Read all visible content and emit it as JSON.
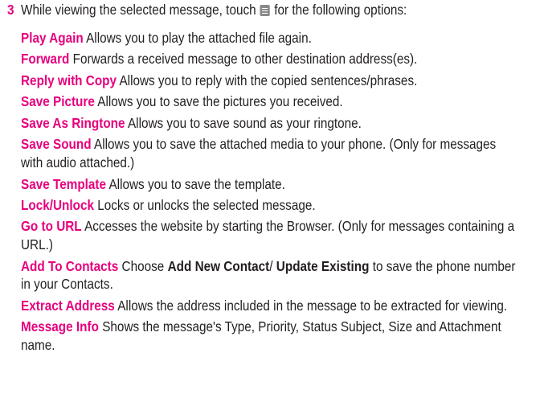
{
  "step": {
    "number": "3",
    "intro_before": "While viewing the selected message, touch",
    "intro_after": "for the following options:"
  },
  "icons": {
    "menu": "menu-key-icon"
  },
  "colors": {
    "accent": "#e6007e",
    "text": "#231f20"
  },
  "options": [
    {
      "title": "Play Again",
      "desc": "Allows you to play the attached file again."
    },
    {
      "title": "Forward",
      "desc": "Forwards a received message to other destination address(es)."
    },
    {
      "title": "Reply with Copy",
      "desc": "Allows you to reply with the copied sentences/phrases."
    },
    {
      "title": "Save Picture",
      "desc": "Allows you to save the pictures you received."
    },
    {
      "title": "Save As Ringtone",
      "desc": "Allows you to save sound as your ringtone."
    },
    {
      "title": "Save Sound",
      "desc": "Allows you to save the attached media to your phone. (Only for messages with audio attached.)"
    },
    {
      "title": "Save Template",
      "desc": "Allows you to save the template."
    },
    {
      "title": "Lock/Unlock",
      "desc": "Locks or unlocks the selected message."
    },
    {
      "title": "Go to URL",
      "desc": "Accesses the website by starting the Browser. (Only for messages containing a URL.)"
    },
    {
      "title": "Add To Contacts",
      "desc_parts": {
        "pre": "Choose",
        "bold1": "Add New Contact",
        "sep": "/",
        "bold2": "Update Existing",
        "post": "to save the phone number in your Contacts."
      }
    },
    {
      "title": "Extract Address",
      "desc": "Allows the address included in the message to be extracted for viewing."
    },
    {
      "title": "Message Info",
      "desc": "Shows the message's Type, Priority, Status Subject, Size and Attachment name."
    }
  ]
}
